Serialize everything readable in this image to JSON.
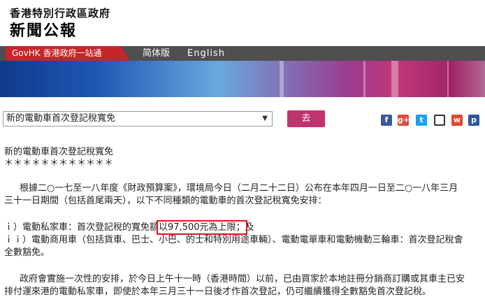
{
  "header": {
    "line1": "香港特別行政區政府",
    "line2": "新聞公報"
  },
  "nav": {
    "govhk": "GovHK 香港政府一站通",
    "simplified": "简体版",
    "english": "English"
  },
  "selector": {
    "value": "新的電動車首次登記稅寬免",
    "arrow": "▼",
    "go_label": "去"
  },
  "share": {
    "facebook": "f",
    "google_plus": "g+",
    "twitter": "t",
    "email": "",
    "weibo": "w",
    "print": "p"
  },
  "article": {
    "title": "新的電動車首次登記稅寬免",
    "stars": "＊＊＊＊＊＊＊＊＊＊＊＊",
    "p1_line1": "根據二○一七至一八年度《財政預算案》，環境局今日（二月二十二日）公布在本年四月一日至二○一八年三月",
    "p1_line2": "三十一日期間（包括首尾兩天），以下不同種類的電動車的首次登記稅寬免安排：",
    "i_prefix": "ｉ）電動私家車：首次登記稅的寬免額",
    "i_highlight": "以97,500元為上限；",
    "i_suffix": "及",
    "ii_line1": "ｉｉ）電動商用車（包括貨車、巴士、小巴、的士和特別用途車輛）、電動電單車和電動機動三輪車：首次登記稅會",
    "ii_line2": "全數豁免。",
    "p3_line1": "政府會實施一次性的安排，於今日上午十一時（香港時間）以前，已由買家於本地註冊分銷商訂購或其車主已安",
    "p3_line2": "排付運來港的電動私家車，即使於本年三月三十一日後才作首次登記，仍可繼續獲得全數豁免首次登記稅。"
  }
}
